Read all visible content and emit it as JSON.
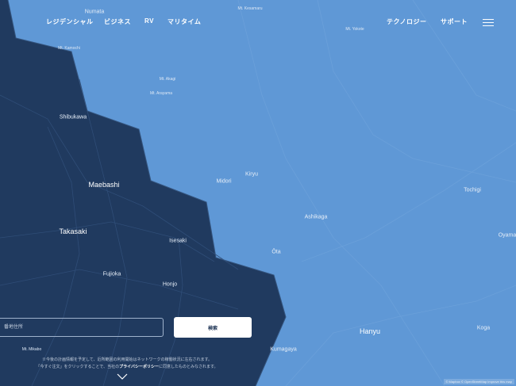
{
  "nav": {
    "items": [
      {
        "label": "レジデンシャル"
      },
      {
        "label": "ビジネス"
      },
      {
        "label": "RV"
      },
      {
        "label": "マリタイム"
      },
      {
        "label": "テクノロジー"
      },
      {
        "label": "サポート"
      }
    ]
  },
  "map": {
    "colors": {
      "covered": "#203a5f",
      "uncovered": "#5f98d6"
    },
    "labels": [
      {
        "text": "Numata",
        "size": "mid"
      },
      {
        "text": "Mt. Kesamaru",
        "size": "small"
      },
      {
        "text": "Mt. Yokote",
        "size": "small"
      },
      {
        "text": "Mt. Kamochi",
        "size": "small"
      },
      {
        "text": "Mt. Akagi",
        "size": "small"
      },
      {
        "text": "Mt. Arayama",
        "size": "small"
      },
      {
        "text": "Shibukawa",
        "size": "mid"
      },
      {
        "text": "Kiryu",
        "size": "mid"
      },
      {
        "text": "Midori",
        "size": "mid"
      },
      {
        "text": "Maebashi",
        "size": "large"
      },
      {
        "text": "Tochigi",
        "size": "mid"
      },
      {
        "text": "Ashikaga",
        "size": "mid"
      },
      {
        "text": "Oyama",
        "size": "mid"
      },
      {
        "text": "Takasaki",
        "size": "large"
      },
      {
        "text": "Isesaki",
        "size": "mid"
      },
      {
        "text": "Ōta",
        "size": "mid"
      },
      {
        "text": "Fujioka",
        "size": "mid"
      },
      {
        "text": "Honjo",
        "size": "mid"
      },
      {
        "text": "Hanyu",
        "size": "large"
      },
      {
        "text": "Koga",
        "size": "mid"
      },
      {
        "text": "Mt. Mikabo",
        "size": "small"
      },
      {
        "text": "Kumagaya",
        "size": "mid"
      }
    ]
  },
  "search": {
    "placeholder": "番地住所",
    "button_label": "検索"
  },
  "disclaimer": {
    "line1": "※今後の計画情報を予定して、近所範囲の利用開始はネットワークの稼働状況に左右されます。",
    "line2_prefix": "「今すぐ注文」をクリックすることで、当社の",
    "privacy_link": "プライバシーポリシー",
    "line2_suffix": "に同意したものとみなされます。"
  },
  "attribution": "© Mapbox © OpenStreetMap Improve this map"
}
